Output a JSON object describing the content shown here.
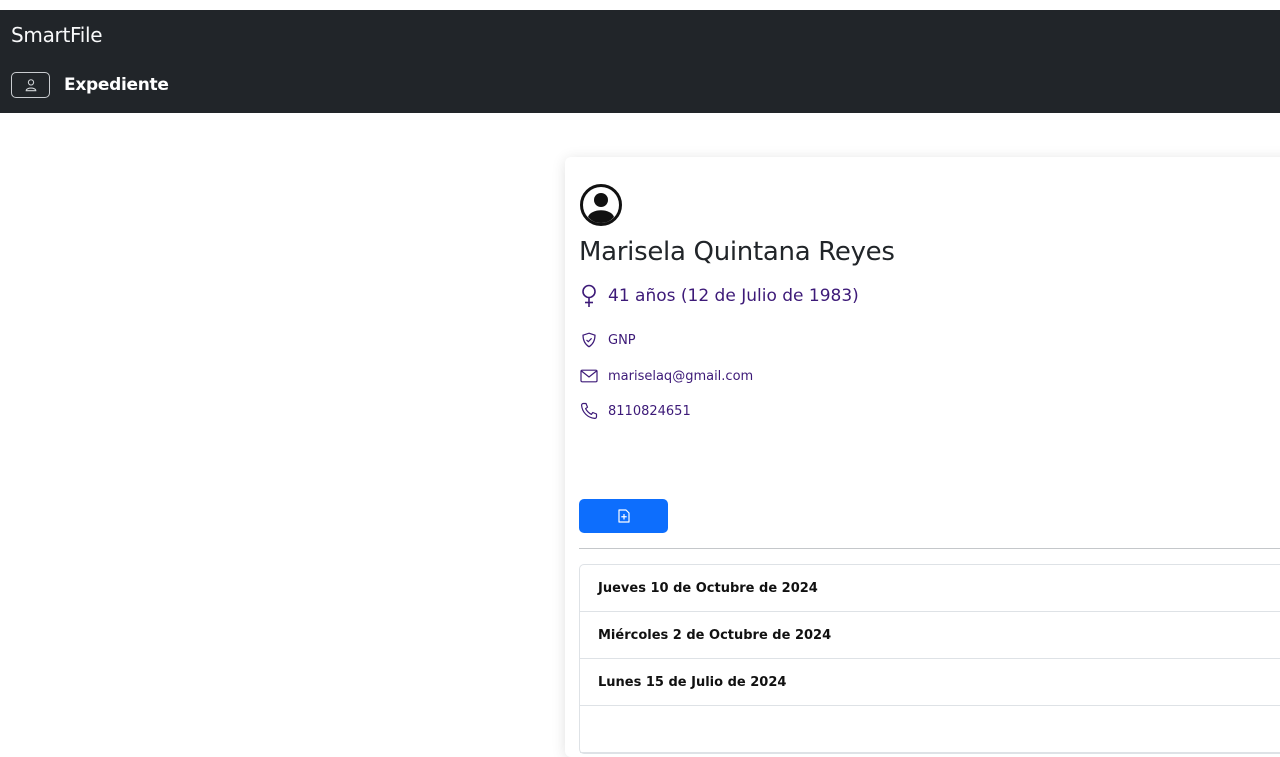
{
  "app": {
    "brand": "SmartFile",
    "nav_label": "Expediente"
  },
  "patient": {
    "name": "Marisela Quintana Reyes",
    "age_text": "41 años (12 de Julio de 1983)",
    "insurance": "GNP",
    "email": "mariselaq@gmail.com",
    "phone": "8110824651"
  },
  "icons": {
    "nav_toggle": "person-icon",
    "avatar": "user-circle-icon",
    "gender": "female-icon",
    "insurance": "shield-check-icon",
    "email": "envelope-icon",
    "phone": "telephone-icon",
    "new_record": "file-plus-icon"
  },
  "colors": {
    "navbar_bg": "#212529",
    "info_text": "#3d1a78",
    "primary_button": "#0d6efd"
  },
  "visits": [
    {
      "date": "Jueves 10 de Octubre de 2024"
    },
    {
      "date": "Miércoles 2 de Octubre de 2024"
    },
    {
      "date": "Lunes 15 de Julio de 2024"
    },
    {
      "date": ""
    }
  ]
}
